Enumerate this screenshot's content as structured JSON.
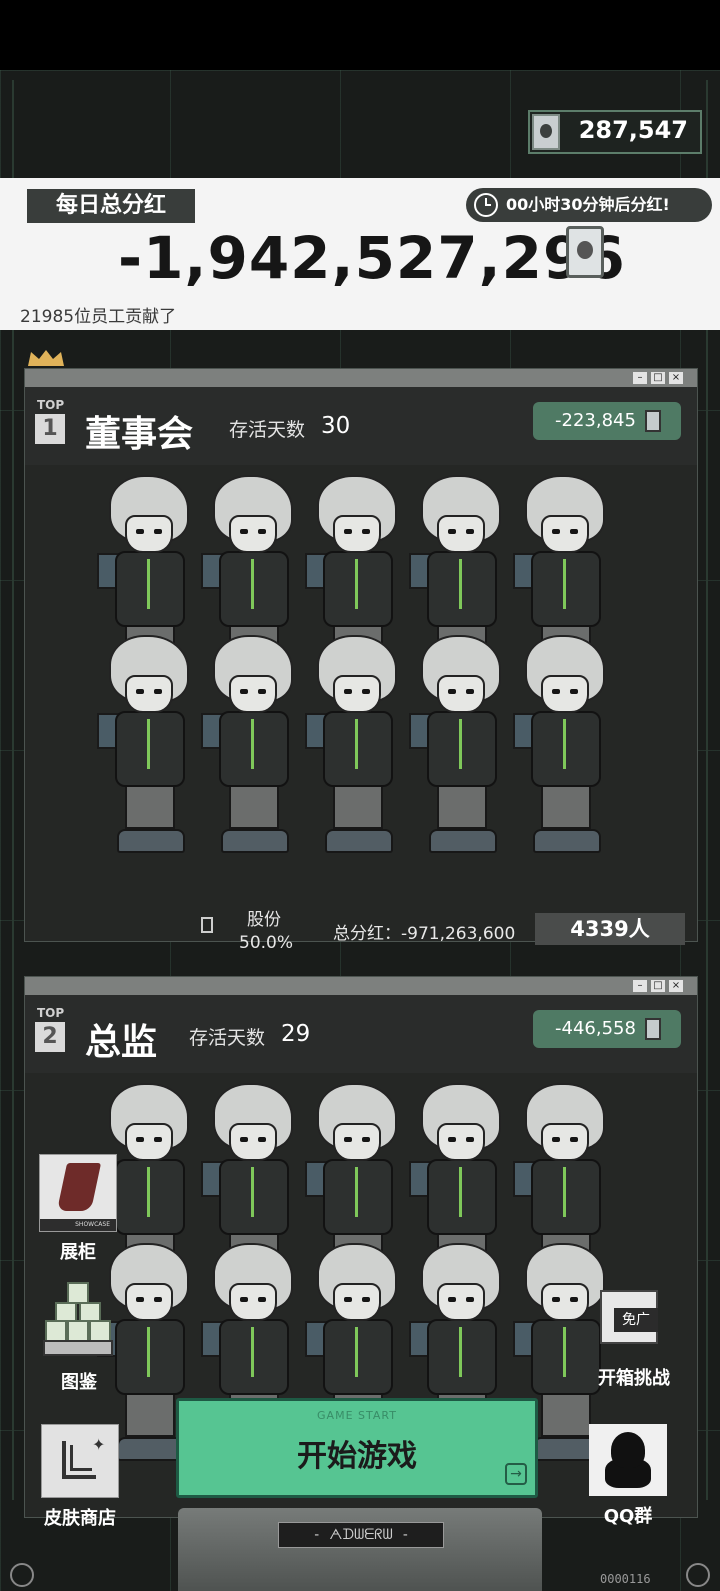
{
  "currency": {
    "value": "287,547",
    "icon": "card-currency-icon"
  },
  "dividend": {
    "label": "每日总分红",
    "timer": "00小时30分钟后分红!",
    "value": "-1,942,527,296",
    "contributors": "21985位员工贡献了"
  },
  "ranks": [
    {
      "top_label": "TOP",
      "rank": "1",
      "name": "董事会",
      "days_label": "存活天数",
      "days": "30",
      "score": "-223,845",
      "shares_label": "股份",
      "shares_pct": "50.0%",
      "total_dividend": "总分红：-971,263,600",
      "people": "4339人"
    },
    {
      "top_label": "TOP",
      "rank": "2",
      "name": "总监",
      "days_label": "存活天数",
      "days": "29",
      "score": "-446,558"
    }
  ],
  "side_buttons": {
    "showcase": "展柜",
    "showcase_strip": "SHOWCASE",
    "atlas": "图鉴",
    "skin_shop": "皮肤商店",
    "box_challenge": "开箱挑战",
    "box_tag": "免广",
    "qq_group": "QQ群"
  },
  "start": {
    "sub": "GAME START",
    "label": "开始游戏"
  },
  "footer": {
    "plate": "- ᗅᗪᗯᗴᖇᗯ -",
    "version": "0000116"
  },
  "colors": {
    "accent": "#56c592",
    "badge": "#4f7a64",
    "dark": "#393d3b"
  }
}
